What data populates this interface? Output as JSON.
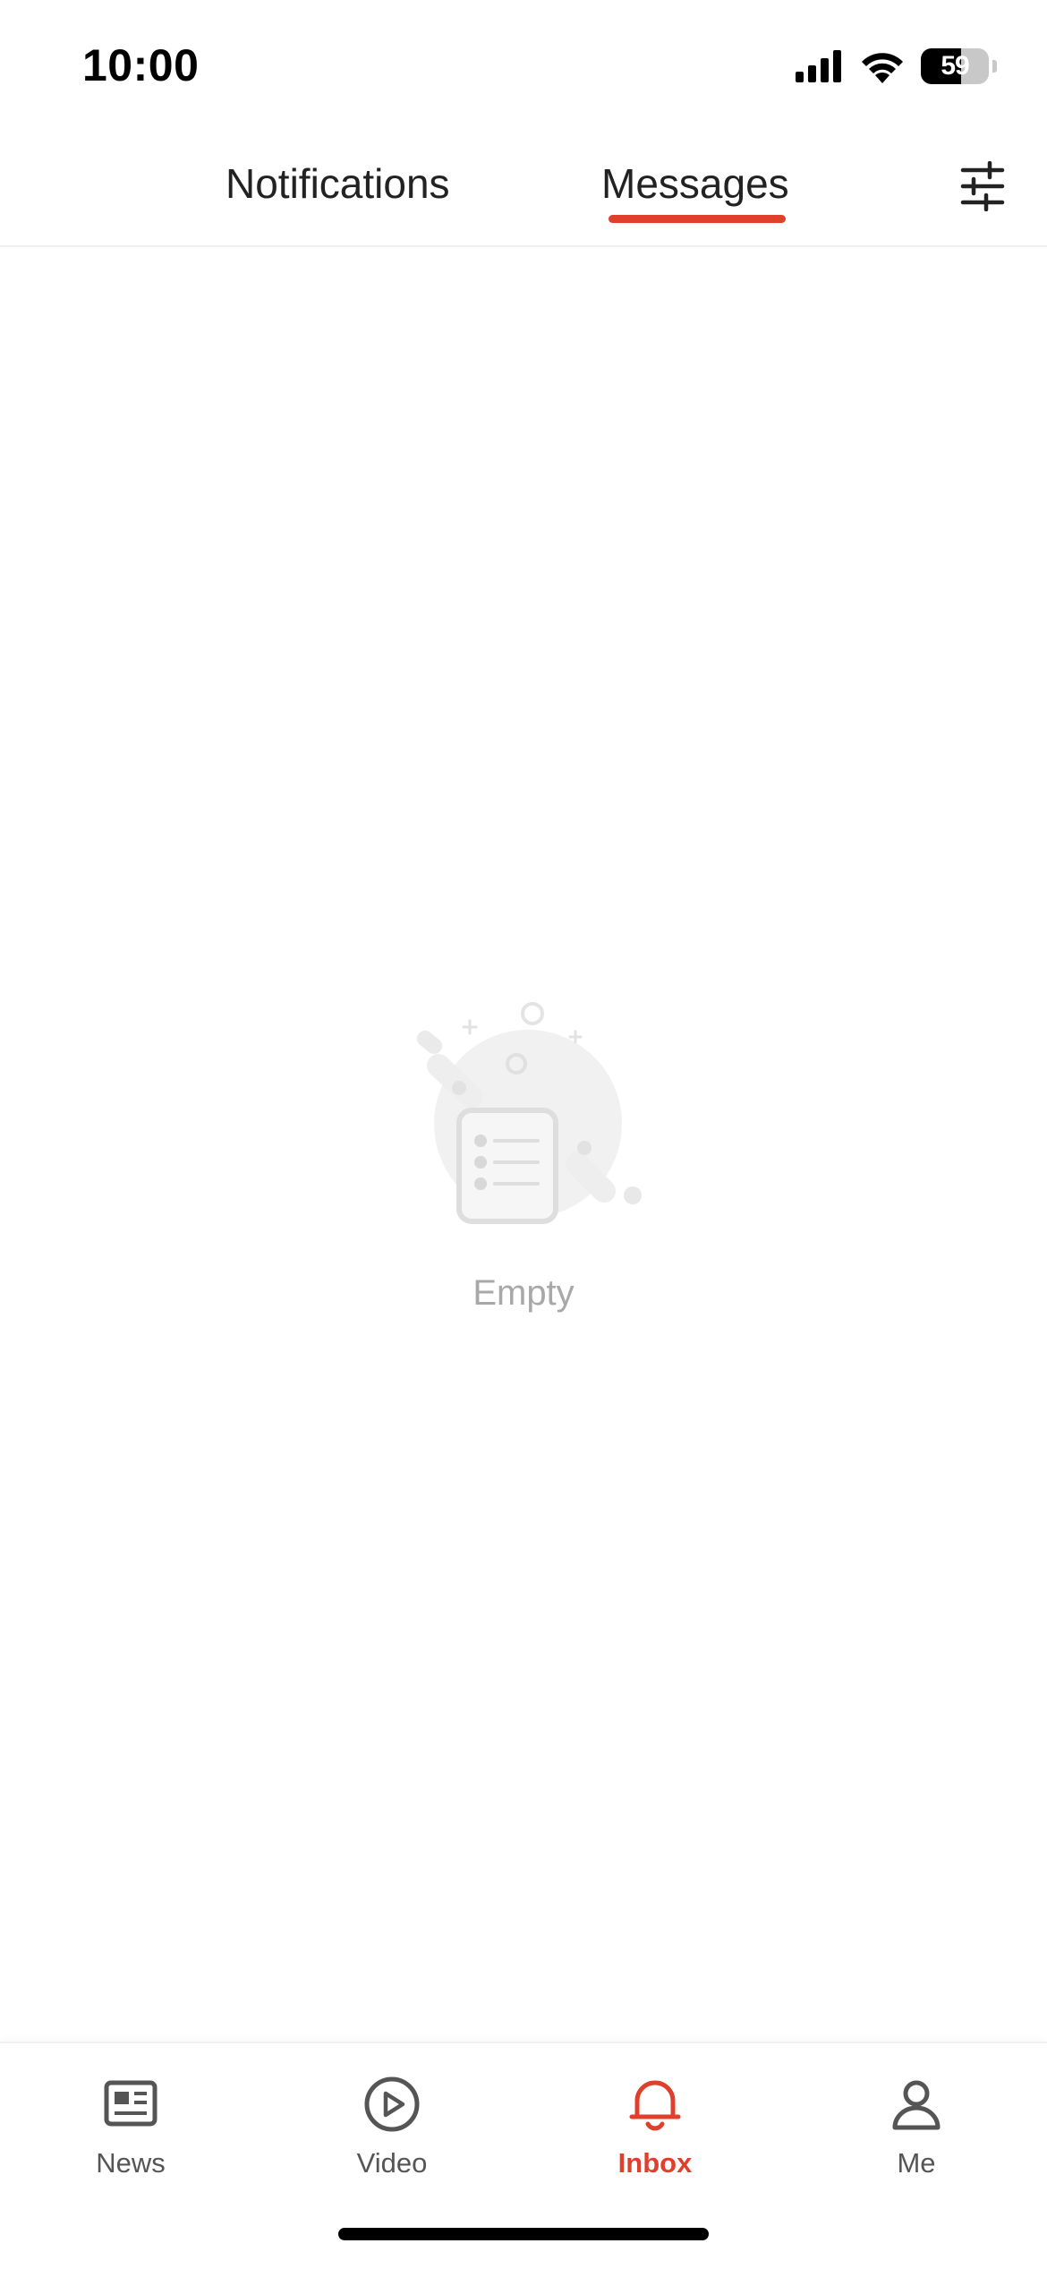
{
  "status_bar": {
    "time": "10:00",
    "battery": "59",
    "battery_level": 0.59
  },
  "top_tabs": {
    "items": [
      {
        "label": "Notifications",
        "active": false
      },
      {
        "label": "Messages",
        "active": true
      }
    ],
    "filter_icon": "sliders-icon"
  },
  "empty_state": {
    "label": "Empty",
    "icon": "empty-list-illustration"
  },
  "bottom_nav": {
    "items": [
      {
        "label": "News",
        "icon": "newspaper-icon",
        "active": false
      },
      {
        "label": "Video",
        "icon": "play-circle-icon",
        "active": false
      },
      {
        "label": "Inbox",
        "icon": "bell-icon",
        "active": true
      },
      {
        "label": "Me",
        "icon": "person-icon",
        "active": false
      }
    ]
  },
  "colors": {
    "accent": "#e0402b",
    "inactive_text": "#555555",
    "muted_text": "#a8a8a8"
  }
}
